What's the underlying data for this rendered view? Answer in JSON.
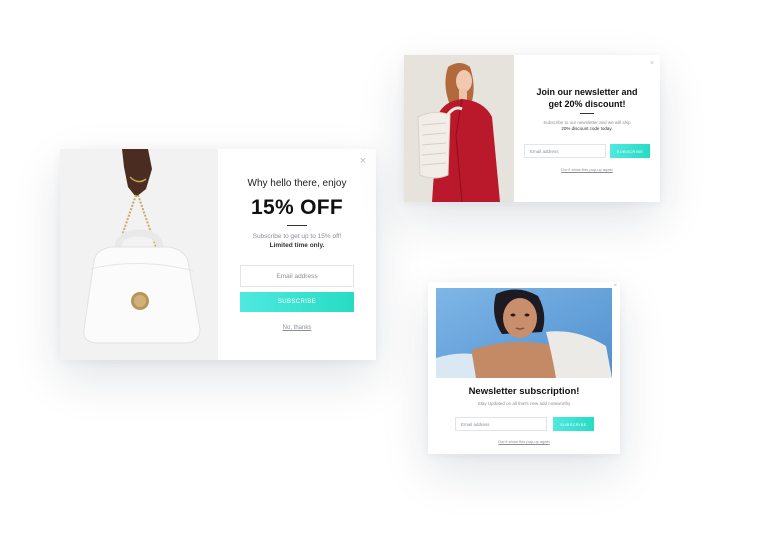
{
  "popups": {
    "bag": {
      "eyebrow": "Why hello there, enjoy",
      "headline": "15% OFF",
      "subtitle": "Subscribe to get up to 15% off!",
      "subtitle_bold": "Limited time only.",
      "email_placeholder": "Email address",
      "cta_label": "SUBSCRIBE",
      "dismiss_label": "No, thanks",
      "close_glyph": "×",
      "photo_icon": "handbag-photo"
    },
    "newsletter_discount": {
      "headline_line1": "Join our newsletter and",
      "headline_line2": "get 20% discount!",
      "subtitle": "Subscribe to our newsletter and we will ship",
      "subtitle_bold": "20% discount code today.",
      "email_placeholder": "Email address",
      "cta_label": "SUBSCRIBE",
      "dismiss_label": "Don't show this pop-up again",
      "close_glyph": "×",
      "photo_icon": "woman-red-coat-photo"
    },
    "newsletter_subscription": {
      "headline": "Newsletter subscription!",
      "subtitle": "Stay Updated on all that's new add noteworthy",
      "email_placeholder": "Email address",
      "cta_label": "SUBSCRIBE",
      "dismiss_label": "Don't show this pop-up again",
      "close_glyph": "×",
      "photo_icon": "woman-portrait-photo"
    }
  },
  "colors": {
    "cta_gradient_start": "#4fe8e0",
    "cta_gradient_end": "#27dcc2",
    "muted_text": "#8b8f98",
    "heading_text": "#111111"
  }
}
